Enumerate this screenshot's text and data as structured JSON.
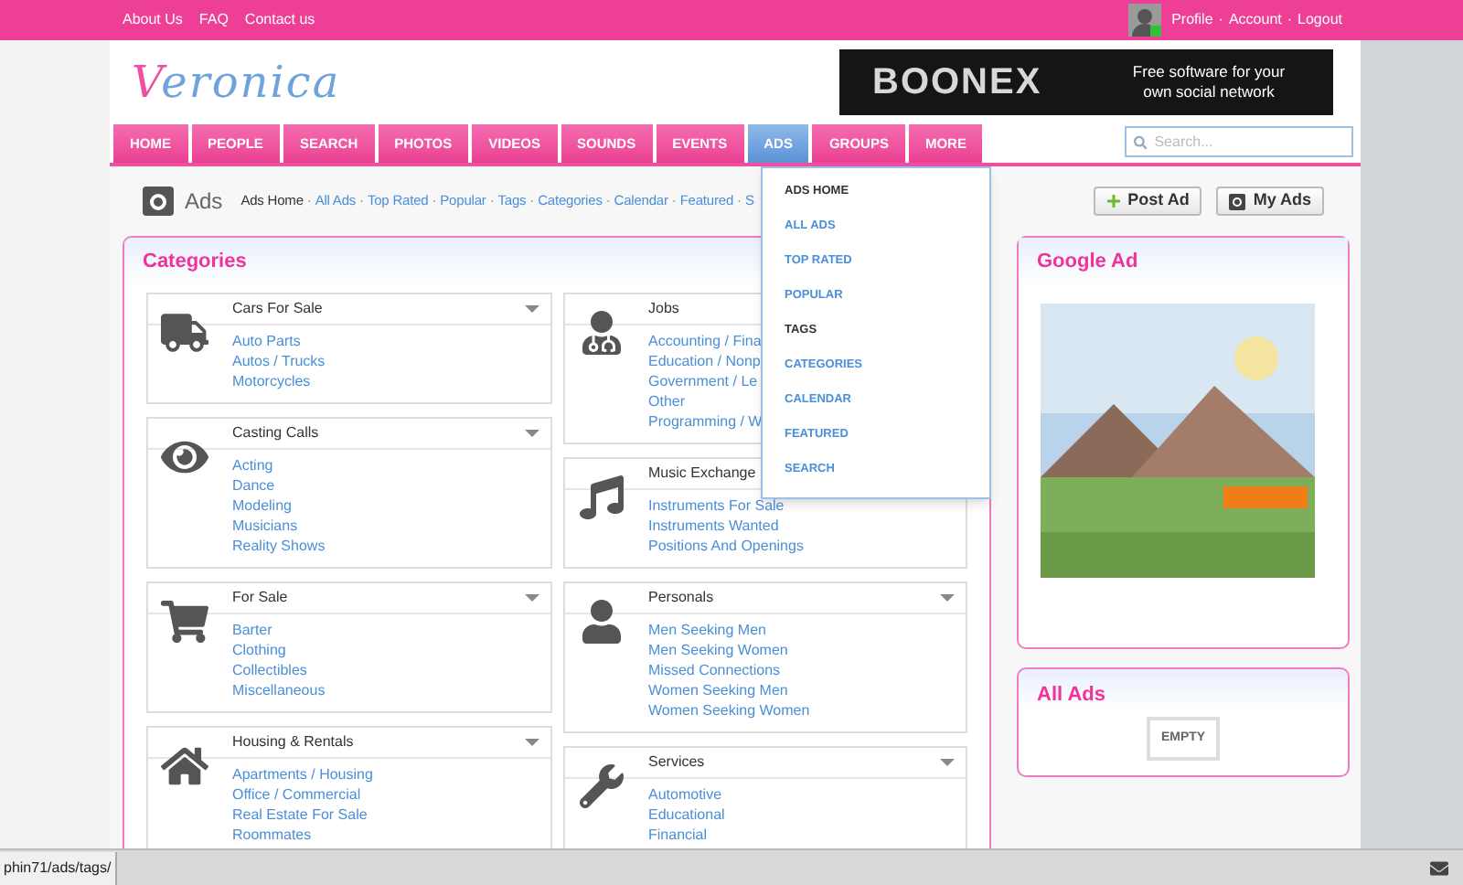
{
  "top_bar": {
    "links": [
      "About Us",
      "FAQ",
      "Contact us"
    ],
    "user_menu": [
      "Profile",
      "Account",
      "Logout"
    ],
    "sep": "·",
    "user_online": true
  },
  "logo": "Veronica",
  "banner": {
    "brand": "BOONEX",
    "tagline": "Free software for your own social network"
  },
  "nav": [
    {
      "label": "HOME",
      "selected": false
    },
    {
      "label": "PEOPLE",
      "selected": false
    },
    {
      "label": "SEARCH",
      "selected": false
    },
    {
      "label": "PHOTOS",
      "selected": false
    },
    {
      "label": "VIDEOS",
      "selected": false
    },
    {
      "label": "SOUNDS",
      "selected": false
    },
    {
      "label": "EVENTS",
      "selected": false
    },
    {
      "label": "ADS",
      "selected": true
    },
    {
      "label": "GROUPS",
      "selected": false
    },
    {
      "label": "MORE",
      "selected": false
    }
  ],
  "search": {
    "placeholder": "Search..."
  },
  "page_title": "Ads",
  "submenu": [
    {
      "label": "Ads Home",
      "selected": true
    },
    {
      "label": "All Ads",
      "selected": false
    },
    {
      "label": "Top Rated",
      "selected": false
    },
    {
      "label": "Popular",
      "selected": false
    },
    {
      "label": "Tags",
      "selected": false
    },
    {
      "label": "Categories",
      "selected": false
    },
    {
      "label": "Calendar",
      "selected": false
    },
    {
      "label": "Featured",
      "selected": false
    },
    {
      "label": "S",
      "selected": false
    }
  ],
  "actions": [
    "Post Ad",
    "My Ads"
  ],
  "dropdown": [
    {
      "label": "ADS HOME",
      "highlighted": true
    },
    {
      "label": "ALL ADS",
      "highlighted": false
    },
    {
      "label": "TOP RATED",
      "highlighted": false
    },
    {
      "label": "POPULAR",
      "highlighted": false
    },
    {
      "label": "TAGS",
      "highlighted": true
    },
    {
      "label": "CATEGORIES",
      "highlighted": false
    },
    {
      "label": "CALENDAR",
      "highlighted": false
    },
    {
      "label": "FEATURED",
      "highlighted": false
    },
    {
      "label": "SEARCH",
      "highlighted": false
    }
  ],
  "categories": {
    "title": "Categories",
    "columns": [
      [
        {
          "title": "Cars For Sale",
          "items": [
            "Auto Parts",
            "Autos / Trucks",
            "Motorcycles"
          ]
        },
        {
          "title": "Casting Calls",
          "items": [
            "Acting",
            "Dance",
            "Modeling",
            "Musicians",
            "Reality Shows"
          ]
        },
        {
          "title": "For Sale",
          "items": [
            "Barter",
            "Clothing",
            "Collectibles",
            "Miscellaneous"
          ]
        },
        {
          "title": "Housing & Rentals",
          "items": [
            "Apartments / Housing",
            "Office / Commercial",
            "Real Estate For Sale",
            "Roommates"
          ]
        }
      ],
      [
        {
          "title": "Jobs",
          "items": [
            "Accounting / Fina",
            "Education / Nonp",
            "Government / Le",
            "Other",
            "Programming / W"
          ]
        },
        {
          "title": "Music Exchange",
          "items": [
            "Instruments For Sale",
            "Instruments Wanted",
            "Positions And Openings"
          ]
        },
        {
          "title": "Personals",
          "items": [
            "Men Seeking Men",
            "Men Seeking Women",
            "Missed Connections",
            "Women Seeking Men",
            "Women Seeking Women"
          ]
        },
        {
          "title": "Services",
          "items": [
            "Automotive",
            "Educational",
            "Financial"
          ]
        }
      ]
    ]
  },
  "google_ad": {
    "title": "Google Ad"
  },
  "all_ads": {
    "title": "All Ads",
    "empty": "EMPTY"
  },
  "status_bar": {
    "url": "phin71/ads/tags/"
  }
}
